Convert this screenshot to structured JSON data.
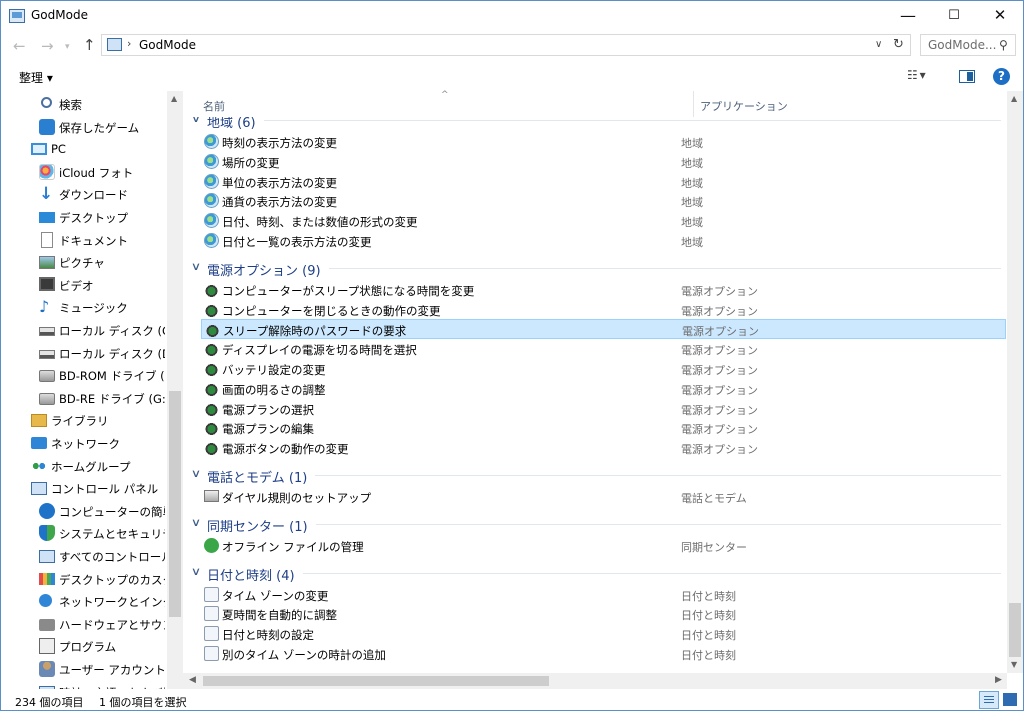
{
  "window": {
    "title": "GodMode"
  },
  "navbar": {
    "back_arrow": "←",
    "forward_arrow": "→",
    "recent_arrow": "▾",
    "up_arrow": "↑",
    "address_separator": "›",
    "address_text": "GodMode",
    "address_dropdown": "∨",
    "refresh_glyph": "↻",
    "search_placeholder": "GodMode...",
    "search_glyph": "⚲"
  },
  "commandbar": {
    "organize_label": "整理 ▾",
    "view_label": "☷ ▾",
    "help_label": "?"
  },
  "navpane": {
    "items": [
      {
        "label": "検索",
        "icon": "search-icon"
      },
      {
        "label": "保存したゲーム",
        "icon": "saved-games-icon"
      },
      {
        "label": "PC",
        "icon": "pc-icon"
      },
      {
        "label": "iCloud フォト",
        "icon": "icloud-photos-icon"
      },
      {
        "label": "ダウンロード",
        "icon": "download-icon"
      },
      {
        "label": "デスクトップ",
        "icon": "desktop-icon"
      },
      {
        "label": "ドキュメント",
        "icon": "documents-icon"
      },
      {
        "label": "ピクチャ",
        "icon": "pictures-icon"
      },
      {
        "label": "ビデオ",
        "icon": "videos-icon"
      },
      {
        "label": "ミュージック",
        "icon": "music-icon"
      },
      {
        "label": "ローカル ディスク (C:)",
        "icon": "drive-icon"
      },
      {
        "label": "ローカル ディスク (D:)",
        "icon": "drive-icon"
      },
      {
        "label": "BD-ROM ドライブ (F:)",
        "icon": "disc-drive-icon"
      },
      {
        "label": "BD-RE ドライブ (G:)",
        "icon": "disc-drive-icon"
      },
      {
        "label": "ライブラリ",
        "icon": "libraries-icon"
      },
      {
        "label": "ネットワーク",
        "icon": "network-icon"
      },
      {
        "label": "ホームグループ",
        "icon": "homegroup-icon"
      },
      {
        "label": "コントロール パネル",
        "icon": "control-panel-icon"
      },
      {
        "label": "コンピューターの簡単操作",
        "icon": "ease-of-access-icon"
      },
      {
        "label": "システムとセキュリティ",
        "icon": "security-shield-icon"
      },
      {
        "label": "すべてのコントロール パネル",
        "icon": "all-control-panel-icon"
      },
      {
        "label": "デスクトップのカスタマイズ",
        "icon": "customization-icon"
      },
      {
        "label": "ネットワークとインターネット",
        "icon": "network-internet-icon"
      },
      {
        "label": "ハードウェアとサウンド",
        "icon": "hardware-sound-icon"
      },
      {
        "label": "プログラム",
        "icon": "programs-icon"
      },
      {
        "label": "ユーザー アカウント",
        "icon": "user-accounts-icon"
      },
      {
        "label": "時計、言語、および地域",
        "icon": "clock-region-icon"
      }
    ]
  },
  "columns": {
    "name": "名前",
    "app": "アプリケーション",
    "sort_glyph": "^"
  },
  "groups": [
    {
      "title": "地域 (6)",
      "items": [
        {
          "name": "時刻の表示方法の変更",
          "app": "地域"
        },
        {
          "name": "場所の変更",
          "app": "地域"
        },
        {
          "name": "単位の表示方法の変更",
          "app": "地域"
        },
        {
          "name": "通貨の表示方法の変更",
          "app": "地域"
        },
        {
          "name": "日付、時刻、または数値の形式の変更",
          "app": "地域"
        },
        {
          "name": "日付と一覧の表示方法の変更",
          "app": "地域"
        }
      ]
    },
    {
      "title": "電源オプション (9)",
      "items": [
        {
          "name": "コンピューターがスリープ状態になる時間を変更",
          "app": "電源オプション"
        },
        {
          "name": "コンピューターを閉じるときの動作の変更",
          "app": "電源オプション"
        },
        {
          "name": "スリープ解除時のパスワードの要求",
          "app": "電源オプション",
          "selected": true
        },
        {
          "name": "ディスプレイの電源を切る時間を選択",
          "app": "電源オプション"
        },
        {
          "name": "バッテリ設定の変更",
          "app": "電源オプション"
        },
        {
          "name": "画面の明るさの調整",
          "app": "電源オプション"
        },
        {
          "name": "電源プランの選択",
          "app": "電源オプション"
        },
        {
          "name": "電源プランの編集",
          "app": "電源オプション"
        },
        {
          "name": "電源ボタンの動作の変更",
          "app": "電源オプション"
        }
      ]
    },
    {
      "title": "電話とモデム (1)",
      "items": [
        {
          "name": "ダイヤル規則のセットアップ",
          "app": "電話とモデム"
        }
      ]
    },
    {
      "title": "同期センター (1)",
      "items": [
        {
          "name": "オフライン ファイルの管理",
          "app": "同期センター"
        }
      ]
    },
    {
      "title": "日付と時刻 (4)",
      "items": [
        {
          "name": "タイム ゾーンの変更",
          "app": "日付と時刻"
        },
        {
          "name": "夏時間を自動的に調整",
          "app": "日付と時刻"
        },
        {
          "name": "日付と時刻の設定",
          "app": "日付と時刻"
        },
        {
          "name": "別のタイム ゾーンの時計の追加",
          "app": "日付と時刻"
        }
      ]
    }
  ],
  "statusbar": {
    "count": "234 個の項目",
    "selection": "1 個の項目を選択"
  },
  "colors": {
    "accent": "#1e3f87",
    "selection_bg": "#cce8ff",
    "selection_border": "#99d1ff"
  }
}
